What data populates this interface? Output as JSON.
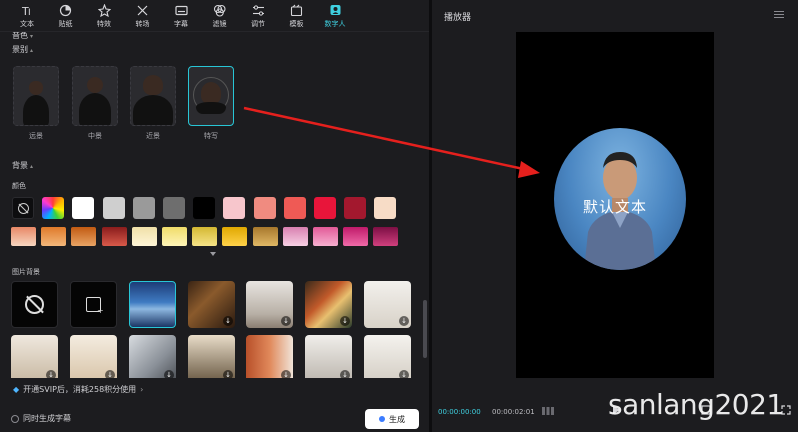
{
  "tabs": [
    {
      "label": "文本",
      "icon": "text-icon",
      "active": false
    },
    {
      "label": "贴纸",
      "icon": "sticker-icon",
      "active": false
    },
    {
      "label": "特效",
      "icon": "effects-icon",
      "active": false
    },
    {
      "label": "转场",
      "icon": "transition-icon",
      "active": false
    },
    {
      "label": "字幕",
      "icon": "subtitle-icon",
      "active": false
    },
    {
      "label": "滤镜",
      "icon": "filter-icon",
      "active": false
    },
    {
      "label": "调节",
      "icon": "adjust-icon",
      "active": false
    },
    {
      "label": "模板",
      "icon": "template-icon",
      "active": false
    },
    {
      "label": "数字人",
      "icon": "digital-human-icon",
      "active": true
    }
  ],
  "sections": {
    "voice": "音色",
    "framing": "景别",
    "background": "背景",
    "color": "颜色",
    "image_bg": "图片背景"
  },
  "framing_options": [
    {
      "label": "远景"
    },
    {
      "label": "中景"
    },
    {
      "label": "近景"
    },
    {
      "label": "特写",
      "selected": true
    }
  ],
  "solid_colors": [
    "none",
    "rainbow",
    "#ffffff",
    "#cfcfcf",
    "#9a9a9a",
    "#6e6e6e",
    "#000000",
    "#f7c6cc",
    "#f08b80",
    "#ef5a55",
    "#e8153a",
    "#a3182e",
    "#f7dcc6"
  ],
  "gradient_colors": [
    [
      "#e88866",
      "#f7d6c0"
    ],
    [
      "#e07a2a",
      "#f2b77a"
    ],
    [
      "#c25a12",
      "#e8a464"
    ],
    [
      "#8a1c1c",
      "#d85a4a"
    ],
    [
      "#f0e0a8",
      "#fff6d8"
    ],
    [
      "#f0dc6a",
      "#fff5b8"
    ],
    [
      "#d4b832",
      "#f6e488"
    ],
    [
      "#e0a800",
      "#ffd24a"
    ],
    [
      "#a8782c",
      "#e0b866"
    ],
    [
      "#d880b0",
      "#f7d0e4"
    ],
    [
      "#e25a98",
      "#f7b0d0"
    ],
    [
      "#c01a6a",
      "#f06aa8"
    ],
    [
      "#7c0f44",
      "#d0407e"
    ]
  ],
  "image_bg": {
    "download_symbol": "↓"
  },
  "svip_text": "开通SVIP后，消耗258积分使用",
  "subtitle_checkbox": "同时生成字幕",
  "generate_button": "生成",
  "player": {
    "title": "播放器",
    "overlay_text": "默认文本",
    "current_time": "00:00:00:00",
    "total_time": "00:00:02:01"
  },
  "watermark": "sanlang2021",
  "colors": {
    "accent": "#28c6d6",
    "annotation_arrow": "#e5201d"
  }
}
